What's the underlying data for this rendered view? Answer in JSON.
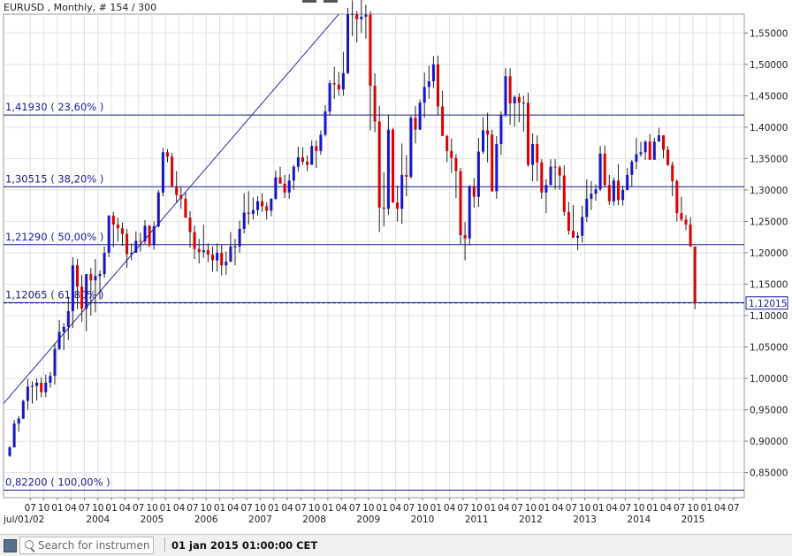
{
  "chart_data": {
    "type": "candlestick",
    "symbol": "EURUSD",
    "header": "EURUSD , Monthly, # 154 / 300",
    "current_price_label": "1,12015",
    "ylim": [
      0.81,
      1.58
    ],
    "y_ticks": [
      0.85,
      0.9,
      0.95,
      1.0,
      1.05,
      1.1,
      1.15,
      1.2,
      1.25,
      1.3,
      1.35,
      1.4,
      1.45,
      1.5,
      1.55
    ],
    "y_tick_labels": [
      "0,85000",
      "0,90000",
      "0,95000",
      "1,00000",
      "1,05000",
      "1,10000",
      "1,15000",
      "1,20000",
      "1,25000",
      "1,30000",
      "1,35000",
      "1,40000",
      "1,45000",
      "1,50000",
      "1,55000"
    ],
    "x_month_labels": [
      "07",
      "10",
      "01",
      "04",
      "07",
      "10",
      "01",
      "04",
      "07",
      "10",
      "01",
      "04",
      "07",
      "10",
      "01",
      "04",
      "07",
      "10",
      "01",
      "04",
      "07",
      "10",
      "01",
      "04",
      "07",
      "10",
      "01",
      "04",
      "07",
      "10",
      "01",
      "04",
      "07",
      "10",
      "01",
      "04",
      "07",
      "10",
      "01",
      "04",
      "07",
      "10",
      "01",
      "04",
      "07",
      "10",
      "01",
      "04",
      "07",
      "10",
      "01",
      "04",
      "07",
      "10",
      "01"
    ],
    "x_year_labels": [
      "jul/01/02",
      "2004",
      "2005",
      "2006",
      "2007",
      "2008",
      "2009",
      "2010",
      "2011",
      "2012",
      "2013",
      "2014",
      "2015"
    ],
    "fib_levels": [
      {
        "value": 1.4193,
        "label": "1,41930 ( 23,60% )"
      },
      {
        "value": 1.30515,
        "label": "1,30515 ( 38,20% )"
      },
      {
        "value": 1.2129,
        "label": "1,21290 ( 50,00% )"
      },
      {
        "value": 1.12065,
        "label": "1,12065 ( 61,80% )"
      },
      {
        "value": 0.822,
        "label": "0,82200 ( 100,00% )"
      }
    ],
    "fib_anchor": {
      "from": {
        "month": "2002-07",
        "price": 0.96
      },
      "to": {
        "month": "2008-07",
        "price": 1.58
      }
    },
    "bull_color": "#1515cc",
    "bear_color": "#dd0000",
    "start_month": "2002-07",
    "candles": [
      [
        0.8766,
        0.892,
        0.875,
        0.89
      ],
      [
        0.89,
        0.934,
        0.89,
        0.928
      ],
      [
        0.928,
        0.94,
        0.915,
        0.936
      ],
      [
        0.936,
        0.966,
        0.935,
        0.964
      ],
      [
        0.964,
        0.999,
        0.95,
        0.987
      ],
      [
        0.987,
        0.995,
        0.96,
        0.988
      ],
      [
        0.988,
        1.0,
        0.965,
        0.993
      ],
      [
        0.993,
        1.001,
        0.97,
        0.978
      ],
      [
        0.978,
        1.006,
        0.97,
        0.993
      ],
      [
        0.993,
        1.01,
        0.985,
        1.004
      ],
      [
        1.004,
        1.056,
        0.99,
        1.047
      ],
      [
        1.047,
        1.093,
        1.045,
        1.074
      ],
      [
        1.074,
        1.088,
        1.045,
        1.082
      ],
      [
        1.082,
        1.13,
        1.061,
        1.107
      ],
      [
        1.107,
        1.193,
        1.08,
        1.18
      ],
      [
        1.18,
        1.19,
        1.11,
        1.146
      ],
      [
        1.146,
        1.165,
        1.09,
        1.111
      ],
      [
        1.111,
        1.144,
        1.075,
        1.166
      ],
      [
        1.166,
        1.176,
        1.1,
        1.156
      ],
      [
        1.156,
        1.19,
        1.105,
        1.163
      ],
      [
        1.163,
        1.172,
        1.126,
        1.166
      ],
      [
        1.166,
        1.21,
        1.16,
        1.2
      ],
      [
        1.2,
        1.26,
        1.193,
        1.259
      ],
      [
        1.259,
        1.265,
        1.209,
        1.245
      ],
      [
        1.245,
        1.256,
        1.218,
        1.239
      ],
      [
        1.239,
        1.248,
        1.211,
        1.23
      ],
      [
        1.23,
        1.238,
        1.176,
        1.198
      ],
      [
        1.198,
        1.215,
        1.188,
        1.2
      ],
      [
        1.2,
        1.234,
        1.2,
        1.219
      ],
      [
        1.219,
        1.232,
        1.202,
        1.218
      ],
      [
        1.218,
        1.252,
        1.214,
        1.243
      ],
      [
        1.243,
        1.244,
        1.209,
        1.212
      ],
      [
        1.212,
        1.25,
        1.205,
        1.242
      ],
      [
        1.242,
        1.3,
        1.24,
        1.296
      ],
      [
        1.296,
        1.367,
        1.29,
        1.36
      ],
      [
        1.36,
        1.365,
        1.344,
        1.353
      ],
      [
        1.353,
        1.359,
        1.305,
        1.305
      ],
      [
        1.305,
        1.33,
        1.28,
        1.292
      ],
      [
        1.292,
        1.305,
        1.27,
        1.286
      ],
      [
        1.286,
        1.296,
        1.255,
        1.256
      ],
      [
        1.256,
        1.266,
        1.208,
        1.233
      ],
      [
        1.233,
        1.243,
        1.19,
        1.206
      ],
      [
        1.206,
        1.222,
        1.183,
        1.201
      ],
      [
        1.201,
        1.245,
        1.192,
        1.204
      ],
      [
        1.204,
        1.215,
        1.185,
        1.197
      ],
      [
        1.197,
        1.21,
        1.17,
        1.188
      ],
      [
        1.188,
        1.215,
        1.17,
        1.2
      ],
      [
        1.2,
        1.213,
        1.164,
        1.18
      ],
      [
        1.18,
        1.202,
        1.165,
        1.186
      ],
      [
        1.186,
        1.233,
        1.185,
        1.21
      ],
      [
        1.21,
        1.222,
        1.18,
        1.21
      ],
      [
        1.21,
        1.251,
        1.2,
        1.238
      ],
      [
        1.238,
        1.295,
        1.231,
        1.264
      ],
      [
        1.264,
        1.298,
        1.245,
        1.262
      ],
      [
        1.262,
        1.288,
        1.253,
        1.268
      ],
      [
        1.268,
        1.29,
        1.259,
        1.282
      ],
      [
        1.282,
        1.295,
        1.265,
        1.274
      ],
      [
        1.274,
        1.28,
        1.253,
        1.267
      ],
      [
        1.267,
        1.287,
        1.258,
        1.286
      ],
      [
        1.286,
        1.331,
        1.284,
        1.32
      ],
      [
        1.32,
        1.337,
        1.311,
        1.31
      ],
      [
        1.31,
        1.324,
        1.287,
        1.296
      ],
      [
        1.296,
        1.325,
        1.286,
        1.315
      ],
      [
        1.315,
        1.34,
        1.3,
        1.337
      ],
      [
        1.337,
        1.369,
        1.329,
        1.352
      ],
      [
        1.352,
        1.368,
        1.34,
        1.345
      ],
      [
        1.345,
        1.355,
        1.33,
        1.34
      ],
      [
        1.34,
        1.379,
        1.34,
        1.37
      ],
      [
        1.37,
        1.379,
        1.335,
        1.362
      ],
      [
        1.362,
        1.395,
        1.356,
        1.388
      ],
      [
        1.388,
        1.435,
        1.385,
        1.425
      ],
      [
        1.425,
        1.475,
        1.42,
        1.47
      ],
      [
        1.47,
        1.496,
        1.445,
        1.468
      ],
      [
        1.468,
        1.488,
        1.45,
        1.46
      ],
      [
        1.46,
        1.52,
        1.45,
        1.486
      ],
      [
        1.486,
        1.59,
        1.485,
        1.58
      ],
      [
        1.58,
        1.602,
        1.545,
        1.58
      ],
      [
        1.58,
        1.585,
        1.535,
        1.572
      ],
      [
        1.572,
        1.604,
        1.55,
        1.576
      ],
      [
        1.576,
        1.595,
        1.541,
        1.579
      ],
      [
        1.579,
        1.585,
        1.395,
        1.466
      ],
      [
        1.466,
        1.486,
        1.392,
        1.409
      ],
      [
        1.409,
        1.434,
        1.233,
        1.272
      ],
      [
        1.272,
        1.328,
        1.242,
        1.27
      ],
      [
        1.27,
        1.42,
        1.26,
        1.396
      ],
      [
        1.396,
        1.399,
        1.28,
        1.28
      ],
      [
        1.28,
        1.307,
        1.25,
        1.27
      ],
      [
        1.27,
        1.374,
        1.246,
        1.324
      ],
      [
        1.324,
        1.355,
        1.29,
        1.321
      ],
      [
        1.321,
        1.418,
        1.318,
        1.415
      ],
      [
        1.415,
        1.434,
        1.374,
        1.396
      ],
      [
        1.396,
        1.444,
        1.396,
        1.439
      ],
      [
        1.439,
        1.487,
        1.415,
        1.464
      ],
      [
        1.464,
        1.498,
        1.445,
        1.473
      ],
      [
        1.473,
        1.513,
        1.462,
        1.5
      ],
      [
        1.5,
        1.514,
        1.42,
        1.433
      ],
      [
        1.433,
        1.458,
        1.386,
        1.386
      ],
      [
        1.386,
        1.388,
        1.344,
        1.362
      ],
      [
        1.362,
        1.382,
        1.327,
        1.351
      ],
      [
        1.351,
        1.357,
        1.287,
        1.33
      ],
      [
        1.33,
        1.335,
        1.214,
        1.228
      ],
      [
        1.228,
        1.249,
        1.188,
        1.223
      ],
      [
        1.223,
        1.308,
        1.212,
        1.306
      ],
      [
        1.306,
        1.319,
        1.272,
        1.289
      ],
      [
        1.289,
        1.383,
        1.273,
        1.361
      ],
      [
        1.361,
        1.416,
        1.357,
        1.395
      ],
      [
        1.395,
        1.423,
        1.344,
        1.388
      ],
      [
        1.388,
        1.396,
        1.297,
        1.298
      ],
      [
        1.298,
        1.386,
        1.286,
        1.373
      ],
      [
        1.373,
        1.425,
        1.356,
        1.419
      ],
      [
        1.419,
        1.494,
        1.416,
        1.481
      ],
      [
        1.481,
        1.494,
        1.404,
        1.438
      ],
      [
        1.438,
        1.451,
        1.401,
        1.448
      ],
      [
        1.448,
        1.454,
        1.408,
        1.439
      ],
      [
        1.439,
        1.45,
        1.393,
        1.439
      ],
      [
        1.439,
        1.455,
        1.337,
        1.34
      ],
      [
        1.34,
        1.39,
        1.314,
        1.373
      ],
      [
        1.373,
        1.387,
        1.314,
        1.344
      ],
      [
        1.344,
        1.349,
        1.286,
        1.296
      ],
      [
        1.296,
        1.317,
        1.263,
        1.308
      ],
      [
        1.308,
        1.349,
        1.307,
        1.337
      ],
      [
        1.337,
        1.349,
        1.301,
        1.336
      ],
      [
        1.336,
        1.339,
        1.3,
        1.323
      ],
      [
        1.323,
        1.339,
        1.259,
        1.265
      ],
      [
        1.265,
        1.281,
        1.229,
        1.235
      ],
      [
        1.235,
        1.276,
        1.229,
        1.224
      ],
      [
        1.224,
        1.233,
        1.204,
        1.227
      ],
      [
        1.227,
        1.275,
        1.216,
        1.257
      ],
      [
        1.257,
        1.317,
        1.249,
        1.286
      ],
      [
        1.286,
        1.314,
        1.268,
        1.294
      ],
      [
        1.294,
        1.309,
        1.283,
        1.301
      ],
      [
        1.301,
        1.37,
        1.298,
        1.358
      ],
      [
        1.358,
        1.371,
        1.304,
        1.308
      ],
      [
        1.308,
        1.324,
        1.276,
        1.282
      ],
      [
        1.282,
        1.32,
        1.275,
        1.315
      ],
      [
        1.315,
        1.341,
        1.276,
        1.284
      ],
      [
        1.284,
        1.307,
        1.275,
        1.3
      ],
      [
        1.3,
        1.335,
        1.299,
        1.324
      ],
      [
        1.324,
        1.348,
        1.305,
        1.345
      ],
      [
        1.345,
        1.383,
        1.333,
        1.357
      ],
      [
        1.357,
        1.377,
        1.353,
        1.36
      ],
      [
        1.36,
        1.379,
        1.348,
        1.377
      ],
      [
        1.377,
        1.389,
        1.351,
        1.348
      ],
      [
        1.348,
        1.383,
        1.356,
        1.377
      ],
      [
        1.377,
        1.399,
        1.379,
        1.387
      ],
      [
        1.387,
        1.383,
        1.35,
        1.364
      ],
      [
        1.364,
        1.37,
        1.338,
        1.34
      ],
      [
        1.34,
        1.345,
        1.29,
        1.314
      ],
      [
        1.314,
        1.317,
        1.25,
        1.263
      ],
      [
        1.263,
        1.289,
        1.25,
        1.253
      ],
      [
        1.253,
        1.26,
        1.236,
        1.245
      ],
      [
        1.245,
        1.257,
        1.21,
        1.21
      ],
      [
        1.21,
        1.21,
        1.11,
        1.12
      ]
    ]
  },
  "statusbar": {
    "search_placeholder": "Search for instrument",
    "timestamp": "01 jan 2015 01:00:00 CET"
  }
}
